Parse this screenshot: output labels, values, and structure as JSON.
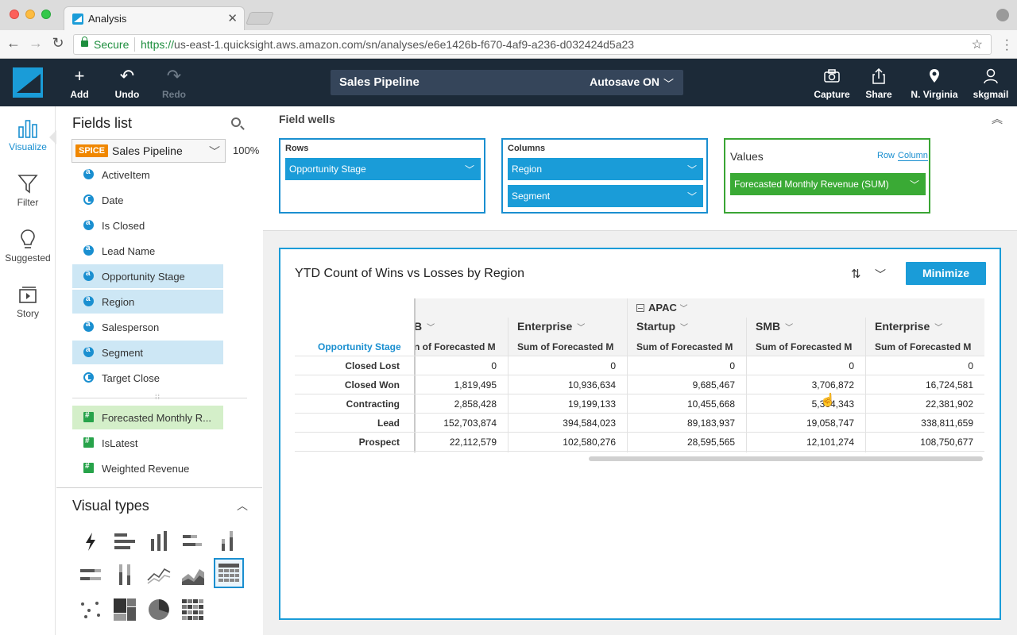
{
  "browser": {
    "tab_title": "Analysis",
    "tab_close": "✕",
    "secure_label": "Secure",
    "url_scheme": "https://",
    "url_rest": "us-east-1.quicksight.aws.amazon.com/sn/analyses/e6e1426b-f670-4af9-a236-d032424d5a23"
  },
  "header": {
    "add": "Add",
    "undo": "Undo",
    "redo": "Redo",
    "analysis_name": "Sales Pipeline",
    "autosave": "Autosave ON",
    "capture": "Capture",
    "share": "Share",
    "region": "N. Virginia",
    "user": "skgmail"
  },
  "rail": {
    "visualize": "Visualize",
    "filter": "Filter",
    "suggested": "Suggested",
    "story": "Story"
  },
  "fields_panel": {
    "title": "Fields list",
    "spice_badge": "SPICE",
    "dataset": "Sales Pipeline",
    "dataset_pct": "100%",
    "dimensions": [
      {
        "label": "ActiveItem",
        "type": "abc",
        "selected": false
      },
      {
        "label": "Date",
        "type": "date",
        "selected": false
      },
      {
        "label": "Is Closed",
        "type": "abc",
        "selected": false
      },
      {
        "label": "Lead Name",
        "type": "abc",
        "selected": false
      },
      {
        "label": "Opportunity Stage",
        "type": "abc",
        "selected": true
      },
      {
        "label": "Region",
        "type": "abc",
        "selected": true
      },
      {
        "label": "Salesperson",
        "type": "abc",
        "selected": false
      },
      {
        "label": "Segment",
        "type": "abc",
        "selected": true
      },
      {
        "label": "Target Close",
        "type": "date",
        "selected": false
      }
    ],
    "measures": [
      {
        "label": "Forecasted Monthly R...",
        "selected": true
      },
      {
        "label": "IsLatest",
        "selected": false
      },
      {
        "label": "Weighted Revenue",
        "selected": false
      }
    ]
  },
  "visual_types": {
    "title": "Visual types",
    "icons": [
      "autograph-icon",
      "horizontal-bar-icon",
      "vertical-bar-icon",
      "horizontal-stacked-bar-icon",
      "vertical-stacked-bar-icon",
      "horizontal-100-bar-icon",
      "vertical-100-bar-icon",
      "line-chart-icon",
      "area-chart-icon",
      "pivot-table-icon",
      "scatter-plot-icon",
      "tree-map-icon",
      "pie-chart-icon",
      "heat-map-icon"
    ],
    "selected": "pivot-table-icon"
  },
  "field_wells": {
    "title": "Field wells",
    "rows_label": "Rows",
    "rows": [
      "Opportunity Stage"
    ],
    "columns_label": "Columns",
    "columns": [
      "Region",
      "Segment"
    ],
    "values_label": "Values",
    "row_toggle": "Row",
    "column_toggle": "Column",
    "values": [
      "Forecasted Monthly Revenue (SUM)"
    ]
  },
  "visual": {
    "title": "YTD Count of Wins vs Losses by Region",
    "minimize": "Minimize",
    "table": {
      "region_header": "APAC",
      "row_dimension": "Opportunity Stage",
      "measure_header": "Sum of Forecasted M",
      "measure_header_cut": "n of Forecasted M",
      "columns": [
        {
          "segment": "B",
          "partial": true
        },
        {
          "segment": "Enterprise",
          "partial": false
        },
        {
          "segment": "Startup",
          "partial": false
        },
        {
          "segment": "SMB",
          "partial": false
        },
        {
          "segment": "Enterprise",
          "partial": false
        }
      ],
      "rows": [
        {
          "label": "Closed Lost",
          "values": [
            "0",
            "0",
            "0",
            "0",
            "0"
          ]
        },
        {
          "label": "Closed Won",
          "values": [
            "1,819,495",
            "10,936,634",
            "9,685,467",
            "3,706,872",
            "16,724,581"
          ]
        },
        {
          "label": "Contracting",
          "values": [
            "2,858,428",
            "19,199,133",
            "10,455,668",
            "5,364,343",
            "22,381,902"
          ]
        },
        {
          "label": "Lead",
          "values": [
            "152,703,874",
            "394,584,023",
            "89,183,937",
            "19,058,747",
            "338,811,659"
          ]
        },
        {
          "label": "Prospect",
          "values": [
            "22,112,579",
            "102,580,276",
            "28,595,565",
            "12,101,274",
            "108,750,677"
          ]
        }
      ]
    }
  },
  "colors": {
    "accent": "#1a9cd8",
    "header_bg": "#1c2a38",
    "values_green": "#3aaa35",
    "spice_orange": "#f08700"
  }
}
